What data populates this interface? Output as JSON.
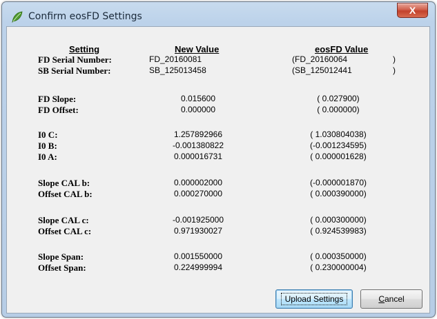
{
  "window": {
    "title": "Confirm eosFD Settings",
    "close_glyph": "X"
  },
  "headers": {
    "setting": "Setting",
    "new_value": "New Value",
    "eosfd_value": "eosFD Value"
  },
  "rows": [
    {
      "label": "FD Serial Number:",
      "new": "FD_20160081",
      "eos": "(FD_20160064",
      "close": ")"
    },
    {
      "label": "SB Serial Number:",
      "new": "SB_125013458",
      "eos": "(SB_125012441",
      "close": ")"
    },
    {
      "label": "FD Slope:",
      "new": "0.015600",
      "eos": "( 0.027900)"
    },
    {
      "label": "FD Offset:",
      "new": "0.000000",
      "eos": "( 0.000000)"
    },
    {
      "label": "I0 C:",
      "new": "1.257892966",
      "eos": "( 1.030804038)"
    },
    {
      "label": "I0 B:",
      "new": "-0.001380822",
      "eos": "(-0.001234595)"
    },
    {
      "label": "I0 A:",
      "new": "0.000016731",
      "eos": "( 0.000001628)"
    },
    {
      "label": "Slope CAL b:",
      "new": "0.000002000",
      "eos": "(-0.000001870)"
    },
    {
      "label": "Offset CAL b:",
      "new": "0.000270000",
      "eos": "( 0.000390000)"
    },
    {
      "label": "Slope CAL c:",
      "new": "-0.001925000",
      "eos": "( 0.000300000)"
    },
    {
      "label": "Offset CAL c:",
      "new": "0.971930027",
      "eos": "( 0.924539983)"
    },
    {
      "label": "Slope Span:",
      "new": "0.001550000",
      "eos": "( 0.000350000)"
    },
    {
      "label": "Offset Span:",
      "new": "0.224999994",
      "eos": "( 0.230000004)"
    }
  ],
  "buttons": {
    "upload_label": "Upload Settings",
    "cancel_accel": "C",
    "cancel_rest": "ancel"
  },
  "colors": {
    "title_bar": "#bcd2ea",
    "client_bg": "#f0f0f0",
    "close_red": "#c2412b",
    "default_button": "#bee6fd"
  },
  "icons": {
    "app": "leaf-icon",
    "close": "close-icon"
  }
}
